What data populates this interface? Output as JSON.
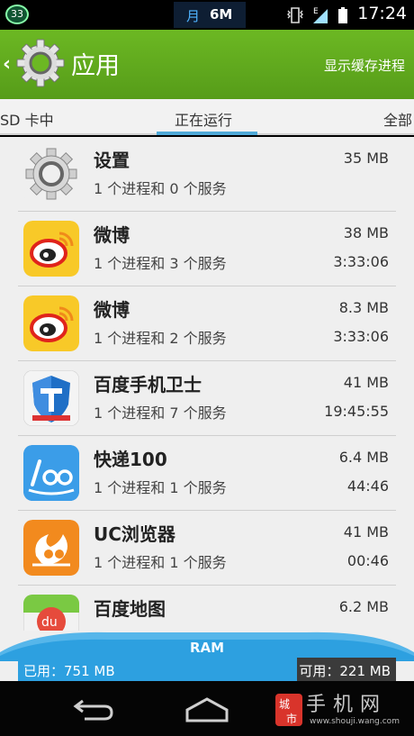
{
  "status_bar": {
    "badge": "33",
    "notice_char": "月",
    "notice_text": "6M",
    "clock": "17:24",
    "network_letter": "E"
  },
  "action_bar": {
    "title": "应用",
    "action_label": "显示缓存进程",
    "accent_color": "#5ea61b"
  },
  "tabs": [
    {
      "label": "SD 卡中"
    },
    {
      "label": "正在运行"
    },
    {
      "label": "全部"
    }
  ],
  "apps": [
    {
      "name": "设置",
      "summary": "1 个进程和 0 个服务",
      "size": "35 MB",
      "time": "",
      "icon": "settings-gear-icon"
    },
    {
      "name": "微博",
      "summary": "1 个进程和 3 个服务",
      "size": "38 MB",
      "time": "3:33:06",
      "icon": "weibo-icon"
    },
    {
      "name": "微博",
      "summary": "1 个进程和 2 个服务",
      "size": "8.3 MB",
      "time": "3:33:06",
      "icon": "weibo-icon"
    },
    {
      "name": "百度手机卫士",
      "summary": "1 个进程和 7 个服务",
      "size": "41 MB",
      "time": "19:45:55",
      "icon": "baidu-guard-icon"
    },
    {
      "name": "快递100",
      "summary": "1 个进程和 1 个服务",
      "size": "6.4 MB",
      "time": "44:46",
      "icon": "kuaidi100-icon"
    },
    {
      "name": "UC浏览器",
      "summary": "1 个进程和 1 个服务",
      "size": "41 MB",
      "time": "00:46",
      "icon": "uc-browser-icon"
    },
    {
      "name": "百度地图",
      "summary": "",
      "size": "6.2 MB",
      "time": "",
      "icon": "baidu-map-icon"
    }
  ],
  "ram": {
    "label": "RAM",
    "used": "已用：751 MB",
    "free": "可用：221 MB",
    "used_color": "#2da0e0"
  },
  "watermark": {
    "seal_text": "城市",
    "text": "手机网",
    "url": "www.shouji.wang.com"
  }
}
